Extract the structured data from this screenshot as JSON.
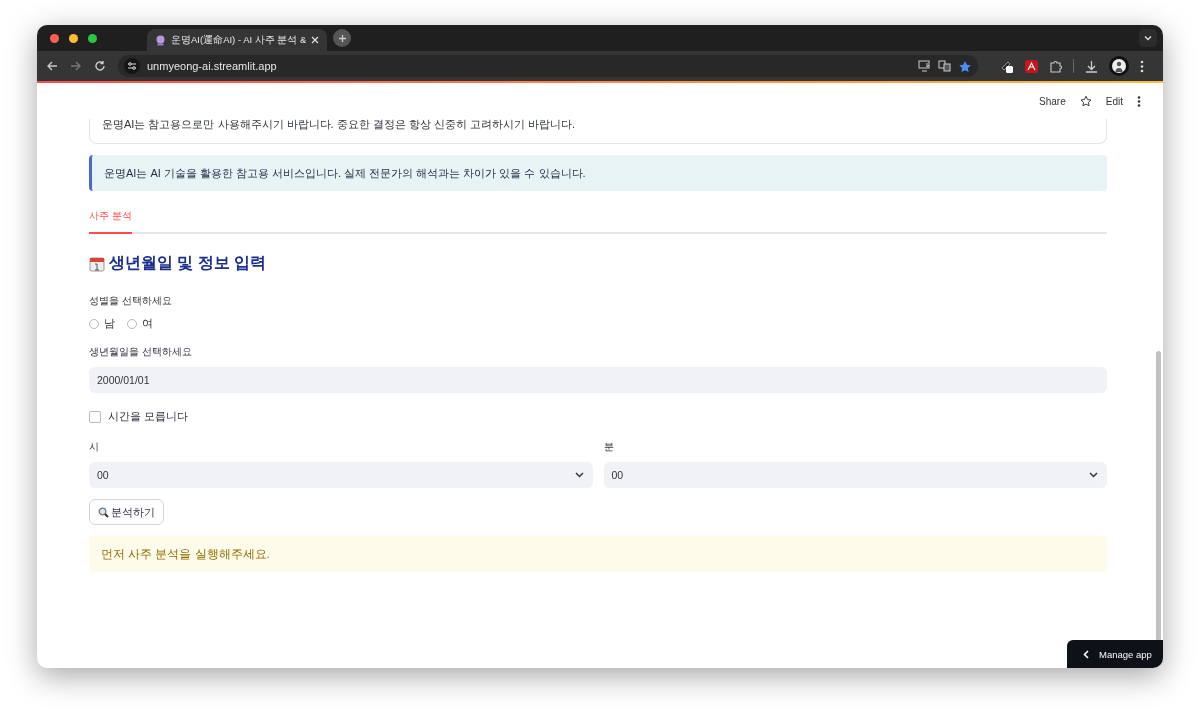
{
  "browser": {
    "tab_title": "운명AI(運命AI) - AI 사주 분석 &",
    "url": "unmyeong-ai.streamlit.app",
    "bookmarked": true
  },
  "header": {
    "share": "Share",
    "edit": "Edit"
  },
  "notice_card": {
    "kind": "card",
    "text": "운명AI는 참고용으로만 사용해주시기 바랍니다. 중요한 결정은 항상 신중히 고려하시기 바랍니다."
  },
  "info_alert": {
    "kind": "info",
    "text": "운명AI는 AI 기술을 활용한 참고용 서비스입니다. 실제 전문가의 해석과는 차이가 있을 수 있습니다."
  },
  "tabs": [
    {
      "label": "사주 분석",
      "selected": true
    }
  ],
  "heading": "생년월일 및 정보 입력",
  "gender": {
    "label": "성별을 선택하세요",
    "options": [
      {
        "label": "남",
        "selected": false
      },
      {
        "label": "여",
        "selected": false
      }
    ]
  },
  "birthdate": {
    "label": "생년월일을 선택하세요",
    "value": "2000/01/01"
  },
  "unknown_time": {
    "label": "시간을 모릅니다",
    "checked": false
  },
  "hour": {
    "label": "시",
    "value": "00"
  },
  "minute": {
    "label": "분",
    "value": "00"
  },
  "analyze_button": "분석하기",
  "warning_alert": {
    "kind": "warning",
    "text": "먼저 사주 분석을 실행해주세요."
  },
  "manage_app": "Manage app"
}
